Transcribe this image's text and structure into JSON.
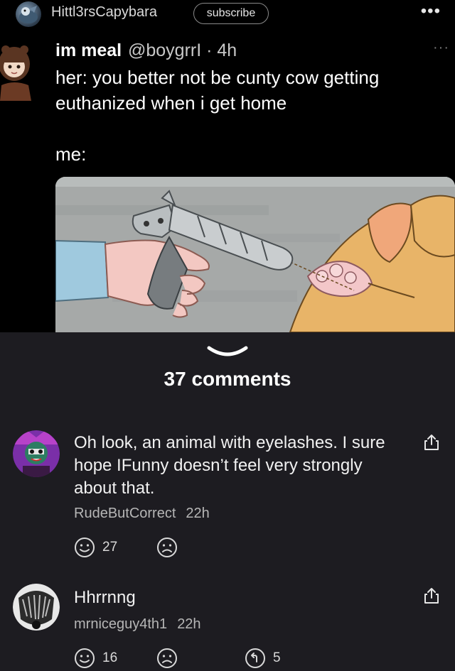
{
  "header": {
    "username": "Hittl3rsCapybara",
    "subscribe_label": "subscribe",
    "more_label": "•••"
  },
  "tweet": {
    "name": "im meal",
    "handle": "@boygrrI · 4h",
    "more_label": "···",
    "text": "her: you better not be cunty cow getting euthanized when i get home",
    "text_me": "me:"
  },
  "comments_section": {
    "count_label": "37 comments",
    "items": [
      {
        "text": "Oh look, an animal with eyelashes. I sure hope IFunny doesn’t feel very strongly about that.",
        "author": "RudeButCorrect",
        "time": "22h",
        "smiles": "27",
        "replies": ""
      },
      {
        "text": "Hhrrnng",
        "author": "mrniceguy4th1",
        "time": "22h",
        "smiles": "16",
        "replies": "5"
      }
    ]
  },
  "colors": {
    "post_bg": "#000000",
    "comments_bg": "#1d1c21",
    "meta_gray": "#b6b6b6"
  }
}
